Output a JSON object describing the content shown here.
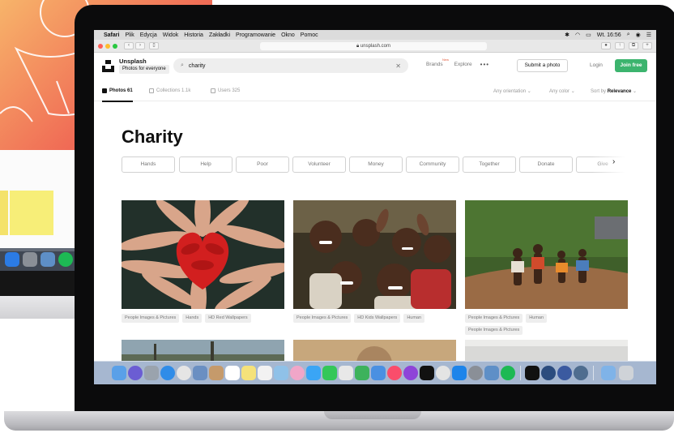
{
  "menubar": {
    "app": "Safari",
    "items": [
      "Plik",
      "Edycja",
      "Widok",
      "Historia",
      "Zakładki",
      "Programowanie",
      "Okno",
      "Pomoc"
    ],
    "clock": "Wt. 16:56"
  },
  "browser": {
    "url": "unsplash.com"
  },
  "nav": {
    "brand": "Unsplash",
    "tagline": "Photos for everyone",
    "search_value": "charity",
    "brands_label": "Brands",
    "new_badge": "New",
    "explore_label": "Explore",
    "more_label": "•••",
    "submit_label": "Submit a photo",
    "login_label": "Login",
    "join_label": "Join free"
  },
  "filters": {
    "tabs": [
      {
        "label": "Photos 61",
        "active": true
      },
      {
        "label": "Collections 1.1k",
        "active": false
      },
      {
        "label": "Users 325",
        "active": false
      }
    ],
    "orientation": "Any orientation",
    "color": "Any color",
    "sort_prefix": "Sort by",
    "sort_value": "Relevance"
  },
  "page_title": "Charity",
  "related": [
    "Hands",
    "Help",
    "Poor",
    "Volunteer",
    "Money",
    "Community",
    "Together",
    "Donate",
    "Give"
  ],
  "photos": [
    {
      "tags": [
        "People Images & Pictures",
        "Hands",
        "HD Red Wallpapers"
      ]
    },
    {
      "tags": [
        "People Images & Pictures",
        "HD Kids Wallpapers",
        "Human"
      ]
    },
    {
      "tags": [
        "People Images & Pictures",
        "Human",
        "People Images & Pictures"
      ]
    }
  ],
  "colors": {
    "accent_green": "#3cb46e",
    "brand_dark": "#111111"
  }
}
